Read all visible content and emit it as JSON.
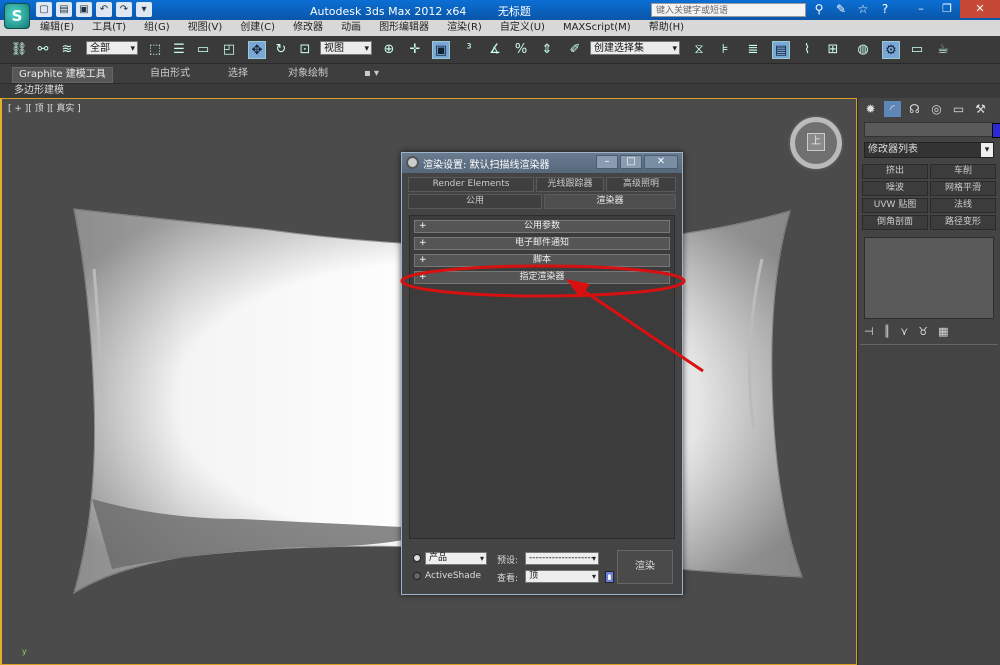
{
  "app": {
    "title": "Autodesk 3ds Max  2012 x64",
    "document": "无标题",
    "search_placeholder": "键入关键字或短语"
  },
  "menu": [
    "编辑(E)",
    "工具(T)",
    "组(G)",
    "视图(V)",
    "创建(C)",
    "修改器",
    "动画",
    "图形编辑器",
    "渲染(R)",
    "自定义(U)",
    "MAXScript(M)",
    "帮助(H)"
  ],
  "toolbar": {
    "selection_filter": "全部",
    "ref_coord": "视图",
    "named_selection": "创建选择集"
  },
  "ribbon": {
    "tabs": [
      "Graphite 建模工具",
      "自由形式",
      "选择",
      "对象绘制"
    ],
    "sub_label": "多边形建模"
  },
  "viewport": {
    "label": "[ + ][ 顶 ][ 真实 ]",
    "viewcube_face": "上",
    "axis": "y"
  },
  "command_panel": {
    "modifier_list": "修改器列表",
    "buttons": [
      "挤出",
      "车削",
      "噪波",
      "网格平滑",
      "UVW 贴图",
      "法线",
      "倒角剖面",
      "路径变形"
    ]
  },
  "render_dialog": {
    "title": "渲染设置: 默认扫描线渲染器",
    "tabs_row1": [
      "Render Elements",
      "光线跟踪器",
      "高级照明"
    ],
    "tabs_row2": [
      "公用",
      "渲染器"
    ],
    "rollouts": [
      "公用参数",
      "电子邮件通知",
      "脚本",
      "指定渲染器"
    ],
    "mode_product": "产品",
    "mode_activeshade": "ActiveShade",
    "preset_label": "预设:",
    "preset_value": "--------------------",
    "view_label": "查看:",
    "view_value": "顶",
    "render_button": "渲染"
  },
  "colors": {
    "highlight": "#d81010",
    "viewport_border": "#e0b030"
  }
}
